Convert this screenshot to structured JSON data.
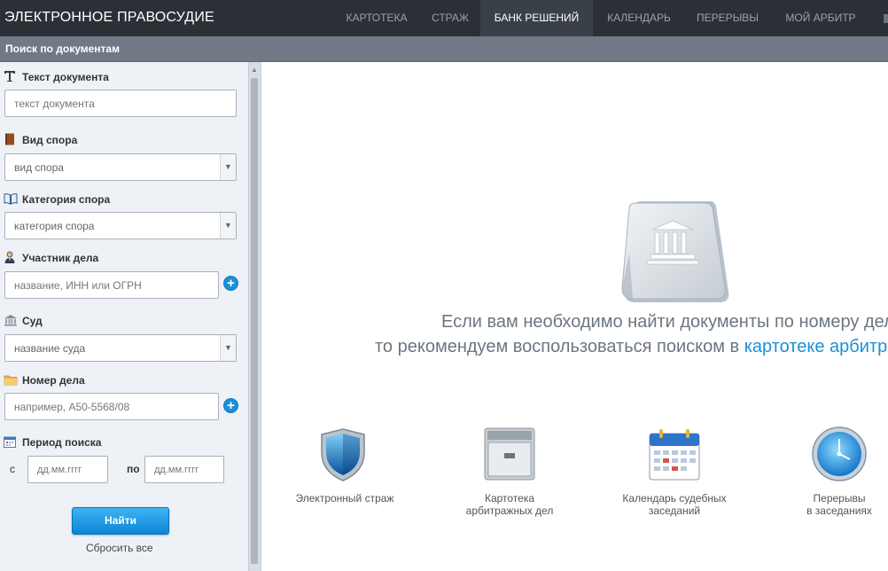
{
  "header": {
    "brand": "ЭЛЕКТРОННОЕ ПРАВОСУДИЕ",
    "nav": [
      {
        "label": "КАРТОТЕКА",
        "active": false
      },
      {
        "label": "СТРАЖ",
        "active": false
      },
      {
        "label": "БАНК РЕШЕНИЙ",
        "active": true
      },
      {
        "label": "КАЛЕНДАРЬ",
        "active": false
      },
      {
        "label": "ПЕРЕРЫВЫ",
        "active": false
      },
      {
        "label": "МОЙ АРБИТР",
        "active": false
      }
    ]
  },
  "sidebar": {
    "title": "Поиск по документам",
    "doc_text": {
      "label": "Текст документа",
      "placeholder": "текст документа"
    },
    "dispute_type": {
      "label": "Вид спора",
      "value": "вид спора"
    },
    "dispute_category": {
      "label": "Категория спора",
      "value": "категория спора"
    },
    "participant": {
      "label": "Участник дела",
      "placeholder": "название, ИНН или ОГРН"
    },
    "court": {
      "label": "Суд",
      "value": "название суда"
    },
    "case_number": {
      "label": "Номер дела",
      "placeholder": "например, А50-5568/08"
    },
    "period": {
      "label": "Период поиска",
      "from_label": "с",
      "to_label": "по",
      "from_placeholder": "дд.мм.гггг",
      "to_placeholder": "дд.мм.гггг"
    },
    "find_button": "Найти",
    "reset_link": "Сбросить все"
  },
  "main": {
    "message_line1": "Если вам необходимо найти документы по номеру дел",
    "message_line2_prefix": "то рекомендуем воспользоваться поиском в ",
    "message_line2_link": "картотеке арбитра",
    "tiles": [
      {
        "line1": "Электронный страж",
        "line2": "",
        "icon": "shield-icon"
      },
      {
        "line1": "Картотека",
        "line2": "арбитражных дел",
        "icon": "cabinet-icon"
      },
      {
        "line1": "Календарь судебных",
        "line2": "заседаний",
        "icon": "calendar-icon"
      },
      {
        "line1": "Перерывы",
        "line2": "в заседаниях",
        "icon": "clock-icon"
      }
    ]
  },
  "colors": {
    "topbar": "#2b3036",
    "subbar": "#6f7a86",
    "sidebar": "#eef2f7",
    "accent": "#1d8fd8"
  }
}
